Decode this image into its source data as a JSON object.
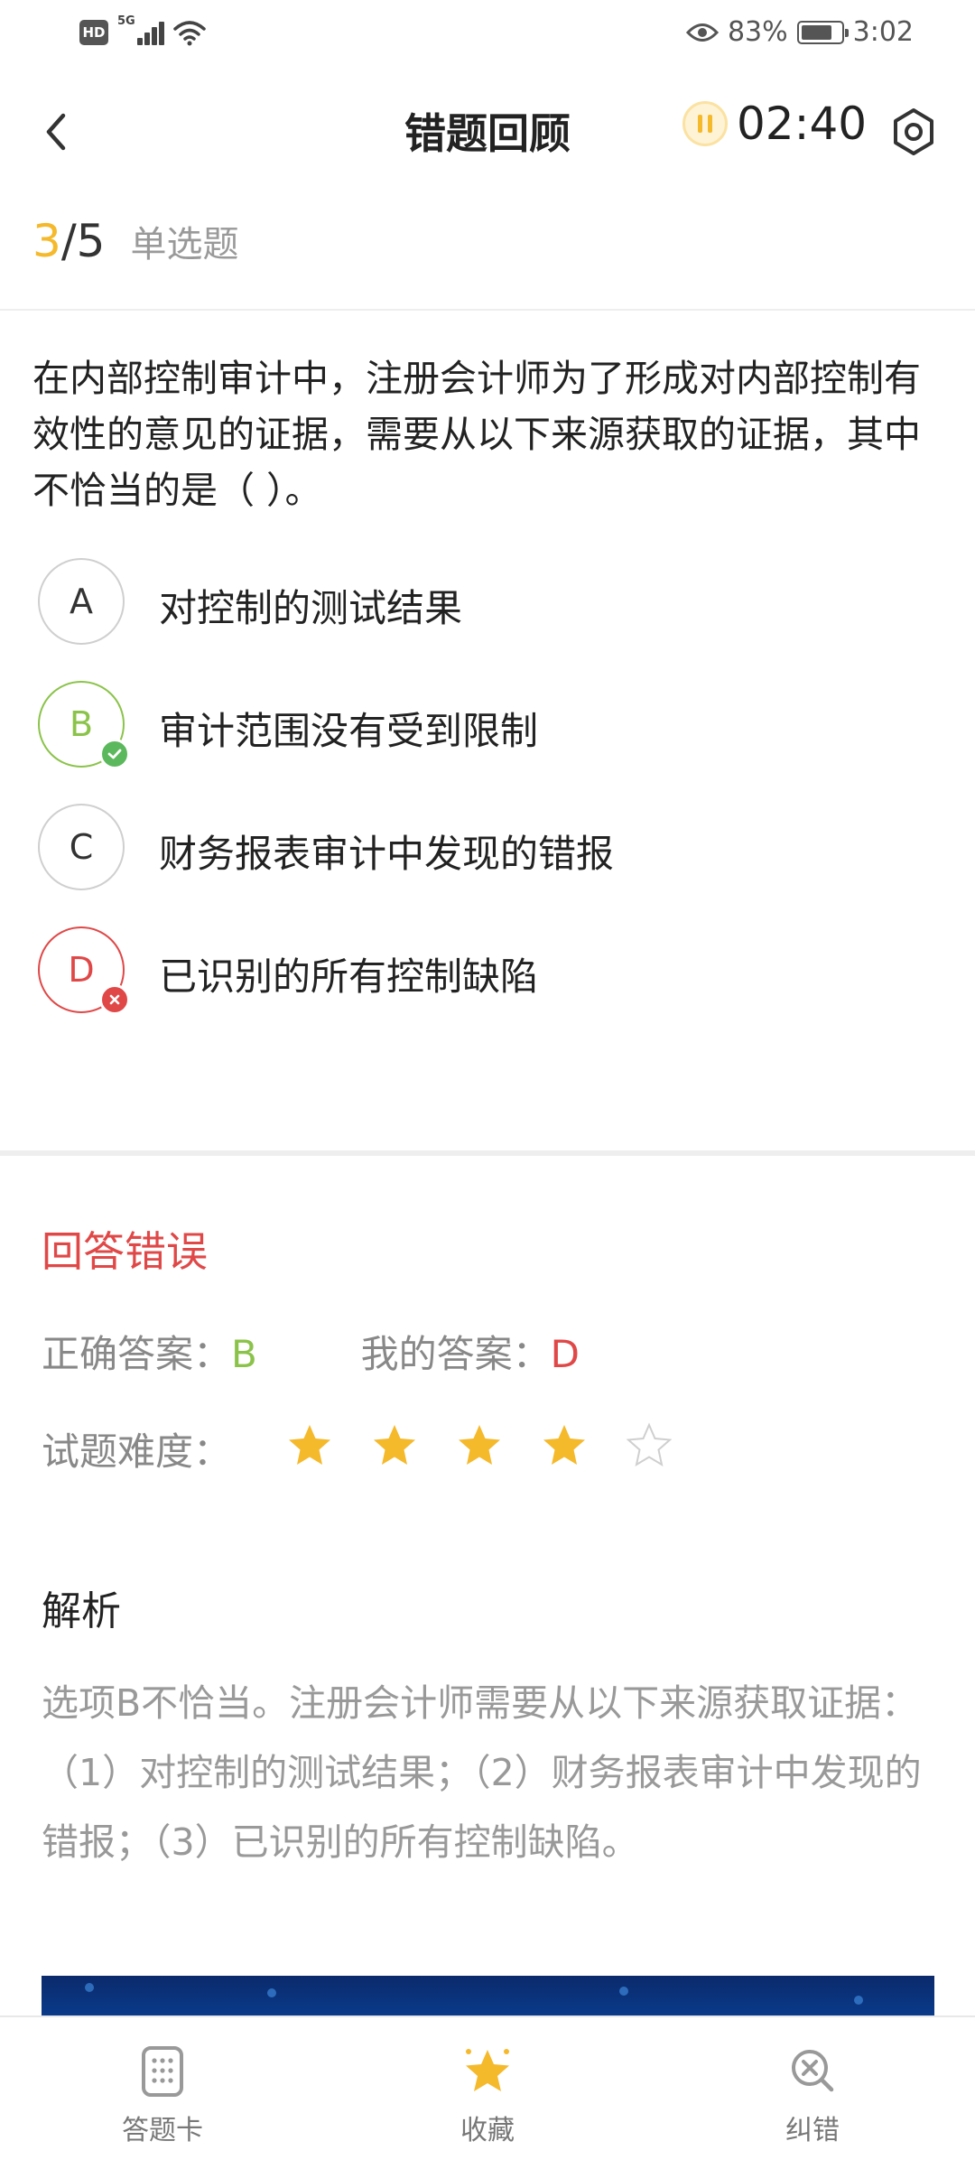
{
  "status_bar": {
    "hd_label": "HD",
    "network_label": "5G",
    "battery_percent": "83%",
    "battery_level": 0.83,
    "time": "3:02"
  },
  "header": {
    "title": "错题回顾",
    "timer": "02:40",
    "back_icon": "chevron-left-icon",
    "pause_icon": "pause-icon",
    "settings_icon": "settings-icon"
  },
  "progress": {
    "current": "3",
    "separator": "/5",
    "question_type": "单选题"
  },
  "question": {
    "text": "在内部控制审计中，注册会计师为了形成对内部控制有效性的意见的证据，需要从以下来源获取的证据，其中不恰当的是（ ）。",
    "options": [
      {
        "letter": "A",
        "text": "对控制的测试结果",
        "state": "normal"
      },
      {
        "letter": "B",
        "text": "审计范围没有受到限制",
        "state": "correct"
      },
      {
        "letter": "C",
        "text": "财务报表审计中发现的错报",
        "state": "normal"
      },
      {
        "letter": "D",
        "text": "已识别的所有控制缺陷",
        "state": "wrong"
      }
    ]
  },
  "result": {
    "title": "回答错误",
    "correct_label": "正确答案：",
    "correct_value": "B",
    "my_label": "我的答案：",
    "my_value": "D",
    "difficulty_label": "试题难度：",
    "difficulty_stars": 4,
    "difficulty_max": 5
  },
  "analysis": {
    "title": "解析",
    "text": "选项B不恰当。注册会计师需要从以下来源获取证据：（1）对控制的测试结果；（2）财务报表审计中发现的错报；（3）已识别的所有控制缺陷。"
  },
  "bottom_bar": {
    "tabs": [
      {
        "label": "答题卡",
        "icon": "answer-card-icon"
      },
      {
        "label": "收藏",
        "icon": "star-icon"
      },
      {
        "label": "纠错",
        "icon": "error-search-icon"
      }
    ]
  },
  "colors": {
    "accent": "#f5b92c",
    "correct": "#8bc34a",
    "wrong": "#e04848",
    "muted": "#999999"
  }
}
